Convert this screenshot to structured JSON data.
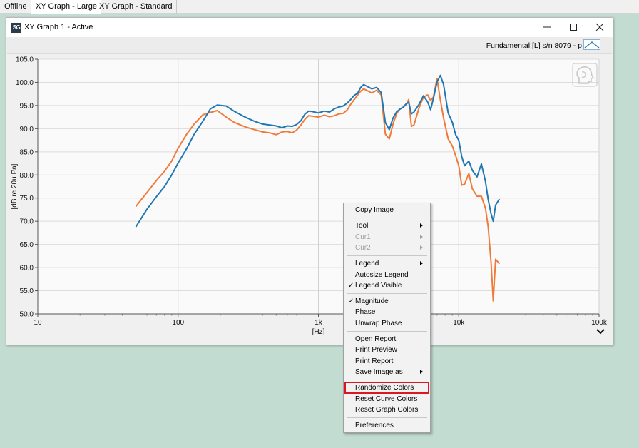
{
  "tabs": [
    {
      "label": "Offline"
    },
    {
      "label": "XY Graph - Large",
      "active": true
    },
    {
      "label": "XY Graph - Standard"
    }
  ],
  "window": {
    "app_icon_text": "SG",
    "title": "XY Graph 1 - Active",
    "controls": [
      "minimize-icon",
      "maximize-icon",
      "close-icon"
    ]
  },
  "legend": {
    "label": "Fundamental [L] s/n 8079 - p",
    "icon": "curve-style-icon"
  },
  "watermark_icon": "head-profile-icon",
  "colors": {
    "series_blue": "#1f77b4",
    "series_orange": "#f07a3a",
    "highlight": "#e0161e",
    "background": "#c2dcd2"
  },
  "chart_data": {
    "type": "line",
    "xlabel": "[Hz]",
    "ylabel": "[dB re 20u Pa]",
    "xscale": "log",
    "xlim": [
      10,
      100000
    ],
    "ylim": [
      50,
      105
    ],
    "grid": true,
    "x_tick_labels": [
      "10",
      "100",
      "1k",
      "10k",
      "100k"
    ],
    "y_tick_labels": [
      "105.0",
      "100.0",
      "95.0",
      "90.0",
      "85.0",
      "80.0",
      "75.0",
      "70.0",
      "65.0",
      "60.0",
      "55.0",
      "50.0"
    ],
    "series": [
      {
        "color": "#f07a3a",
        "points": [
          [
            50,
            73.2
          ],
          [
            60,
            76.2
          ],
          [
            70,
            78.8
          ],
          [
            80,
            80.8
          ],
          [
            90,
            83
          ],
          [
            100,
            85.8
          ],
          [
            115,
            88.8
          ],
          [
            130,
            91
          ],
          [
            150,
            93
          ],
          [
            170,
            93.5
          ],
          [
            190,
            93.9
          ],
          [
            220,
            92.5
          ],
          [
            250,
            91.4
          ],
          [
            300,
            90.4
          ],
          [
            350,
            89.8
          ],
          [
            400,
            89.3
          ],
          [
            450,
            89.1
          ],
          [
            500,
            88.7
          ],
          [
            550,
            89.3
          ],
          [
            600,
            89.4
          ],
          [
            650,
            89.1
          ],
          [
            700,
            89.7
          ],
          [
            750,
            90.8
          ],
          [
            800,
            92
          ],
          [
            850,
            92.8
          ],
          [
            900,
            92.7
          ],
          [
            1000,
            92.5
          ],
          [
            1100,
            92.9
          ],
          [
            1200,
            92.6
          ],
          [
            1300,
            92.8
          ],
          [
            1400,
            93.2
          ],
          [
            1500,
            93.3
          ],
          [
            1600,
            94
          ],
          [
            1700,
            95.3
          ],
          [
            1800,
            96.3
          ],
          [
            1900,
            97.2
          ],
          [
            2000,
            98.1
          ],
          [
            2100,
            98.6
          ],
          [
            2200,
            98.3
          ],
          [
            2400,
            97.7
          ],
          [
            2600,
            98.3
          ],
          [
            2800,
            97.3
          ],
          [
            3000,
            88.8
          ],
          [
            3200,
            87.8
          ],
          [
            3400,
            91
          ],
          [
            3600,
            93.2
          ],
          [
            3800,
            94.3
          ],
          [
            4000,
            94.6
          ],
          [
            4200,
            95.1
          ],
          [
            4400,
            96.3
          ],
          [
            4600,
            90.5
          ],
          [
            4800,
            90.8
          ],
          [
            5200,
            94.4
          ],
          [
            5600,
            96.8
          ],
          [
            6000,
            97.3
          ],
          [
            6300,
            96.1
          ],
          [
            6600,
            96.8
          ],
          [
            7000,
            100.8
          ],
          [
            7400,
            96.2
          ],
          [
            7800,
            92.3
          ],
          [
            8400,
            87.8
          ],
          [
            9000,
            86.3
          ],
          [
            9500,
            84.2
          ],
          [
            10000,
            82
          ],
          [
            10500,
            77.8
          ],
          [
            11000,
            78
          ],
          [
            11800,
            80.3
          ],
          [
            12500,
            77
          ],
          [
            13500,
            75.4
          ],
          [
            14500,
            75.4
          ],
          [
            15500,
            72.8
          ],
          [
            16200,
            68.8
          ],
          [
            17000,
            61
          ],
          [
            17600,
            52.8
          ],
          [
            18300,
            61.8
          ],
          [
            19500,
            60.8
          ]
        ]
      },
      {
        "color": "#1f77b4",
        "points": [
          [
            50,
            68.8
          ],
          [
            60,
            72.6
          ],
          [
            70,
            75.3
          ],
          [
            80,
            77.5
          ],
          [
            90,
            80
          ],
          [
            100,
            82.6
          ],
          [
            115,
            85.7
          ],
          [
            130,
            88.8
          ],
          [
            150,
            91.6
          ],
          [
            170,
            94.3
          ],
          [
            190,
            95.1
          ],
          [
            220,
            94.9
          ],
          [
            250,
            93.8
          ],
          [
            300,
            92.5
          ],
          [
            350,
            91.6
          ],
          [
            400,
            91
          ],
          [
            450,
            90.8
          ],
          [
            500,
            90.6
          ],
          [
            550,
            90.2
          ],
          [
            600,
            90.6
          ],
          [
            650,
            90.5
          ],
          [
            700,
            90.9
          ],
          [
            750,
            91.7
          ],
          [
            800,
            93.1
          ],
          [
            850,
            93.8
          ],
          [
            900,
            93.7
          ],
          [
            1000,
            93.4
          ],
          [
            1100,
            93.8
          ],
          [
            1200,
            93.6
          ],
          [
            1300,
            94.3
          ],
          [
            1400,
            94.7
          ],
          [
            1500,
            94.9
          ],
          [
            1600,
            95.5
          ],
          [
            1700,
            96.3
          ],
          [
            1800,
            97.2
          ],
          [
            1900,
            97.6
          ],
          [
            2000,
            98.9
          ],
          [
            2100,
            99.5
          ],
          [
            2200,
            99.2
          ],
          [
            2400,
            98.6
          ],
          [
            2600,
            98.9
          ],
          [
            2800,
            97.8
          ],
          [
            3000,
            91.3
          ],
          [
            3200,
            89.8
          ],
          [
            3400,
            92.3
          ],
          [
            3600,
            93.6
          ],
          [
            3800,
            94.2
          ],
          [
            4000,
            94.6
          ],
          [
            4200,
            95.3
          ],
          [
            4400,
            95.7
          ],
          [
            4600,
            93.2
          ],
          [
            4800,
            93.6
          ],
          [
            5200,
            95.2
          ],
          [
            5600,
            97.1
          ],
          [
            6000,
            95.8
          ],
          [
            6300,
            94.1
          ],
          [
            6600,
            96.5
          ],
          [
            7000,
            100.1
          ],
          [
            7400,
            101.5
          ],
          [
            7800,
            99.5
          ],
          [
            8400,
            93.4
          ],
          [
            9000,
            91.4
          ],
          [
            9500,
            88.7
          ],
          [
            10000,
            87.5
          ],
          [
            10500,
            84
          ],
          [
            11000,
            82
          ],
          [
            11800,
            83
          ],
          [
            12500,
            81
          ],
          [
            13500,
            79.6
          ],
          [
            14500,
            82.4
          ],
          [
            15500,
            78.6
          ],
          [
            16200,
            74.7
          ],
          [
            17000,
            71.6
          ],
          [
            17600,
            70
          ],
          [
            18300,
            73.5
          ],
          [
            19500,
            74.8
          ]
        ]
      }
    ]
  },
  "context_menu": {
    "items": [
      {
        "label": "Copy Image"
      },
      {
        "label": "Tool",
        "submenu": true
      },
      {
        "label": "Cur1",
        "submenu": true,
        "disabled": true
      },
      {
        "label": "Cur2",
        "submenu": true,
        "disabled": true
      },
      {
        "label": "Legend",
        "submenu": true
      },
      {
        "label": "Autosize Legend"
      },
      {
        "label": "Legend Visible",
        "checked": true
      },
      {
        "label": "Magnitude",
        "checked": true
      },
      {
        "label": "Phase"
      },
      {
        "label": "Unwrap Phase"
      },
      {
        "label": "Open Report"
      },
      {
        "label": "Print Preview"
      },
      {
        "label": "Print Report"
      },
      {
        "label": "Save Image as",
        "submenu": true
      },
      {
        "label": "Randomize Colors",
        "highlighted": true
      },
      {
        "label": "Reset Curve Colors"
      },
      {
        "label": "Reset Graph Colors"
      },
      {
        "label": "Preferences"
      }
    ],
    "check_mark": "✓"
  }
}
